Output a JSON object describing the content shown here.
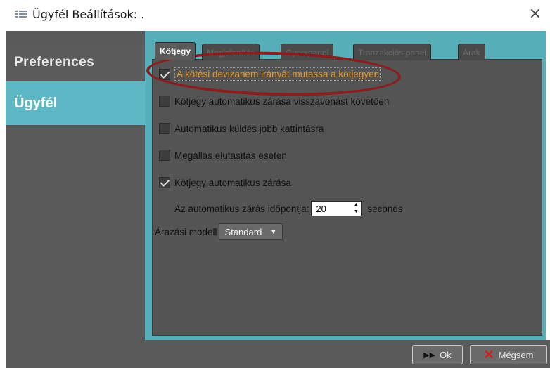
{
  "window": {
    "title": "Ügyfél Beállítások: .",
    "close_symbol": "×",
    "app_icon": "app-icon"
  },
  "sidebar": {
    "items": [
      {
        "label": "Preferences"
      },
      {
        "label": "Ügyfél"
      }
    ]
  },
  "tabs": [
    {
      "label": "Kötjegy"
    },
    {
      "label": "Megjelenítés"
    },
    {
      "label": "Gyorspanel"
    },
    {
      "label": "Tranzakciós panel"
    },
    {
      "label": "Árak"
    }
  ],
  "options": [
    {
      "label": "A kötési devizanem irányát mutassa a kötjegyen",
      "checked": true
    },
    {
      "label": "Kötjegy automatikus zárása visszavonást követően",
      "checked": false
    },
    {
      "label": "Automatikus küldés jobb kattintásra",
      "checked": false
    },
    {
      "label": "Megállás elutasítás esetén",
      "checked": false
    },
    {
      "label": "Kötjegy automatikus zárása",
      "checked": true
    }
  ],
  "auto_close": {
    "label": "Az automatikus zárás időpontja:",
    "value": "20",
    "unit": "seconds"
  },
  "pricing": {
    "label": "Árazási modell",
    "selected": "Standard"
  },
  "buttons": {
    "ok_label": "Ok",
    "cancel_label": "Mégsem"
  },
  "colors": {
    "accent": "#5cb8c4",
    "highlight_text": "#e59a2c",
    "annotation": "#8a1d1d"
  }
}
